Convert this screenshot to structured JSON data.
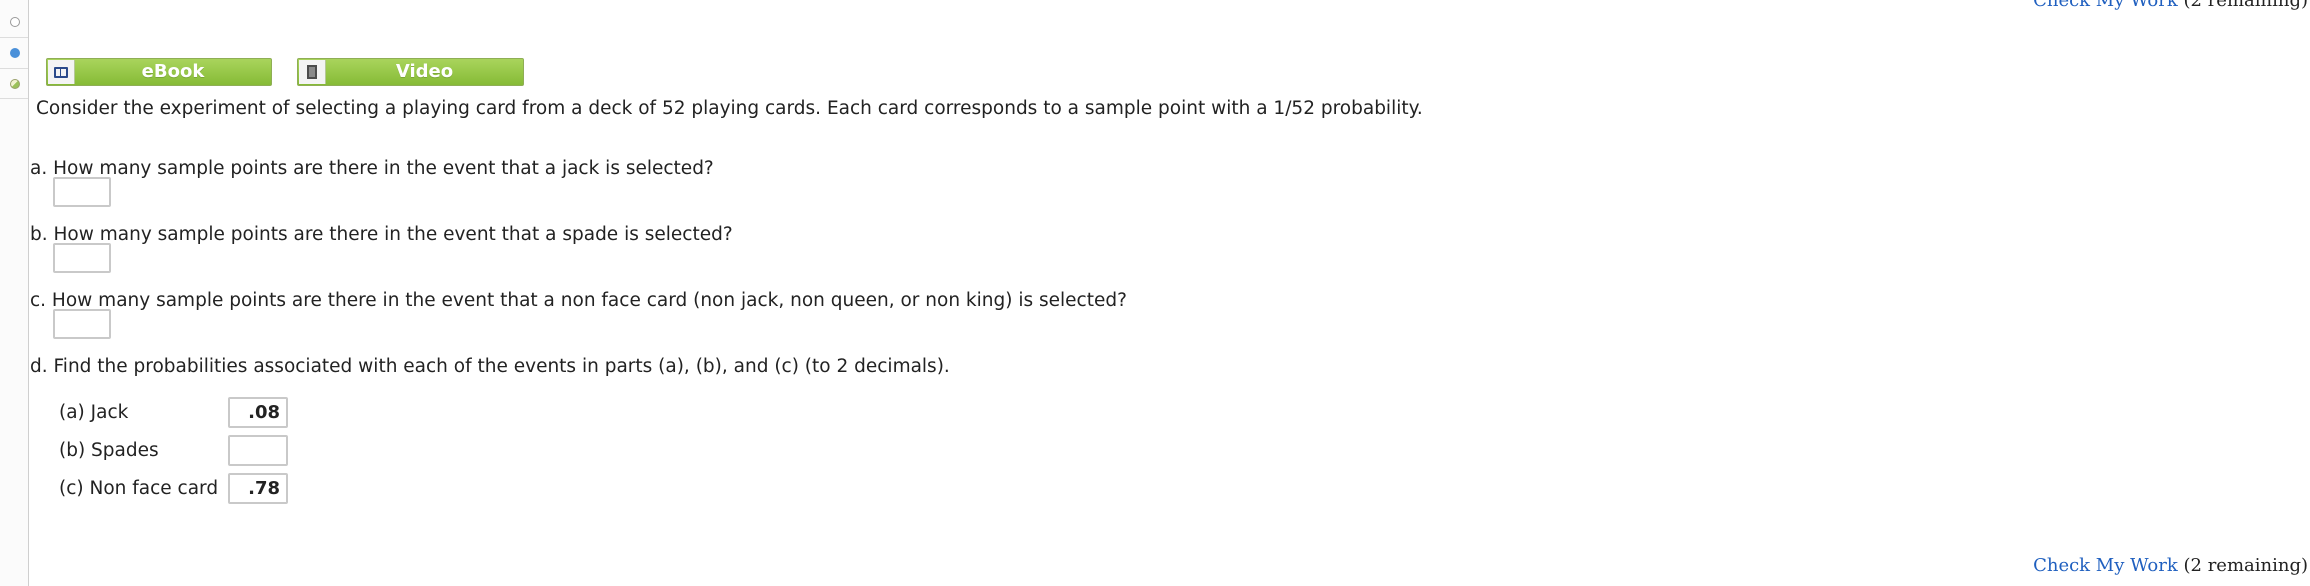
{
  "nav": {
    "check_my_work": "Check My Work",
    "remaining": "(2 remaining)"
  },
  "resources": {
    "ebook_label": "eBook",
    "video_label": "Video"
  },
  "question": {
    "intro": "Consider the experiment of selecting a playing card from a deck of 52 playing cards. Each card corresponds to a sample point with a 1/52 probability.",
    "part_a": "a. How many sample points are there in the event that a jack is selected?",
    "part_b": "b. How many sample points are there in the event that a spade is selected?",
    "part_c": "c. How many sample points are there in the event that a non face card (non jack, non queen, or non king) is selected?",
    "part_d": "d. Find the probabilities associated with each of the events in parts (a), (b), and (c) (to 2 decimals)."
  },
  "answers": {
    "a_value": "",
    "b_value": "",
    "c_value": ""
  },
  "probabilities": [
    {
      "label": "(a) Jack",
      "value": ".08"
    },
    {
      "label": "(b) Spades",
      "value": ""
    },
    {
      "label": "(c) Non face card",
      "value": ".78"
    }
  ],
  "icons": {
    "rail": [
      "radio-empty-icon",
      "radio-filled-icon",
      "partial-credit-icon"
    ],
    "ebook": "book-icon",
    "video": "film-icon"
  },
  "colors": {
    "button_green": "#86bb36",
    "link_blue": "#1f5fbf",
    "status_blue": "#4a90d9"
  }
}
